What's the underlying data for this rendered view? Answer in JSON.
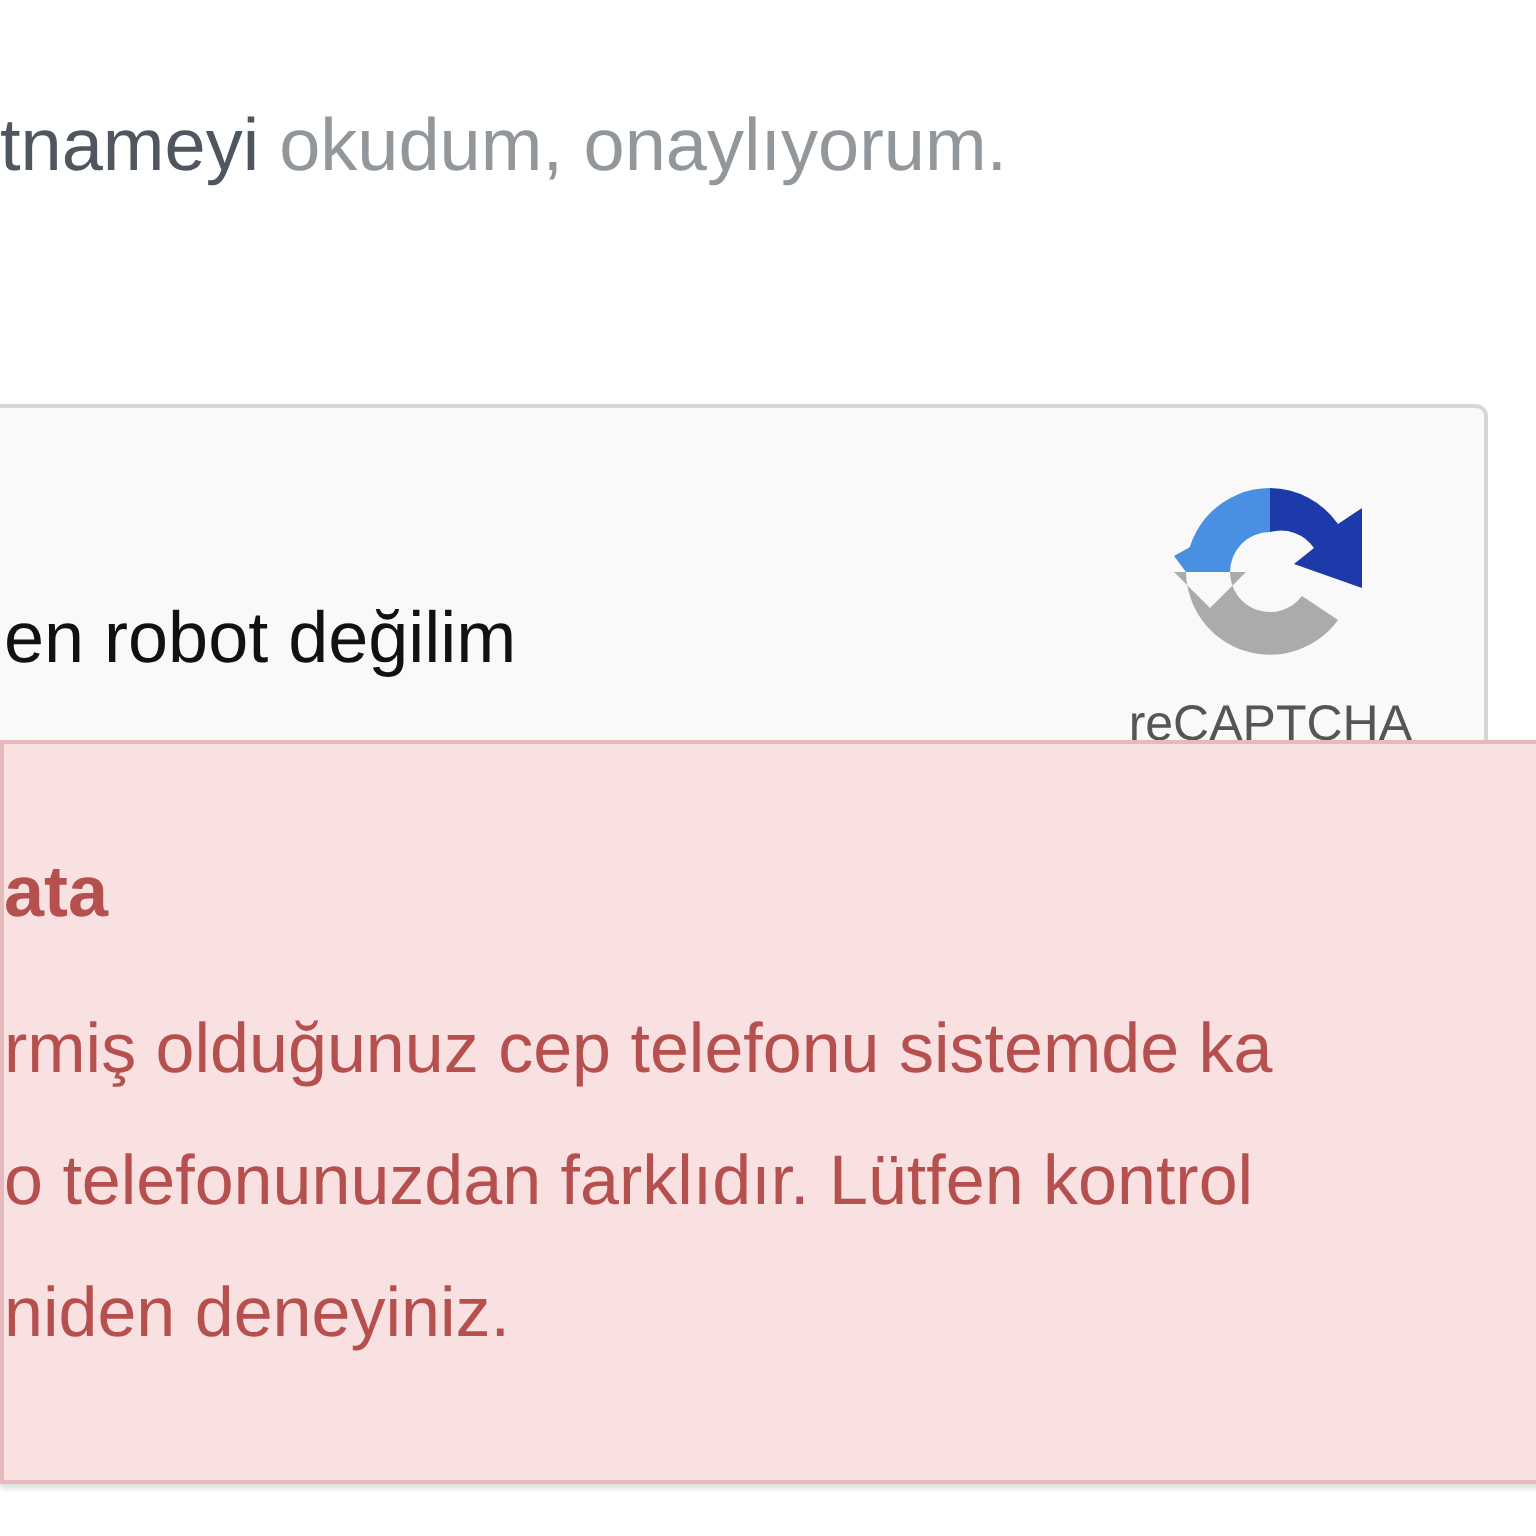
{
  "consent": {
    "link": "tnameyi",
    "text": "okudum, onaylıyorum."
  },
  "captcha": {
    "label": "en robot değilim",
    "brand": "reCAPTCHA"
  },
  "alert": {
    "title": "ata",
    "lines": [
      "rmiş olduğunuz cep telefonu sistemde ka",
      "o telefonunuzdan farklıdır. Lütfen kontrol",
      "niden deneyiniz."
    ]
  }
}
